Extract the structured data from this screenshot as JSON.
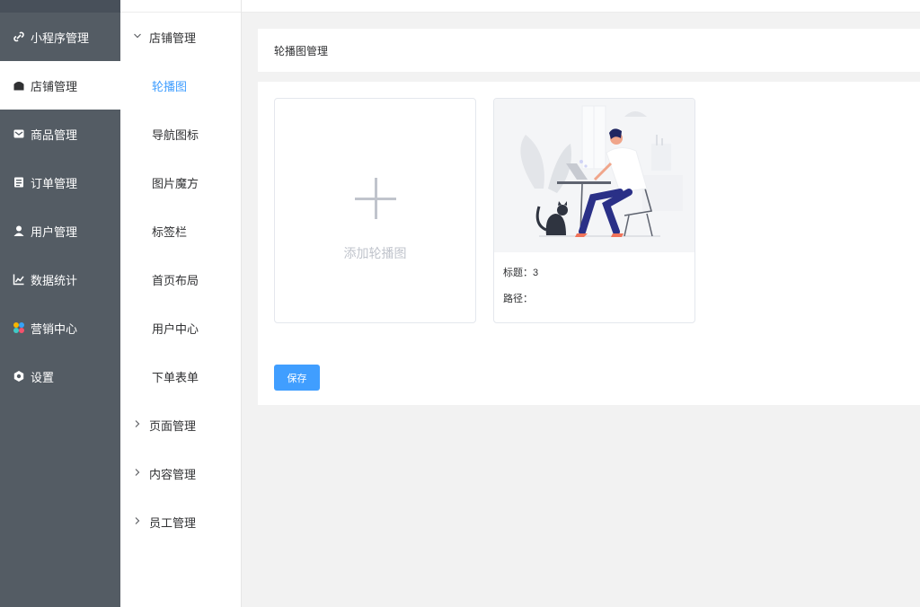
{
  "sidebar": {
    "items": [
      {
        "label": "小程序管理",
        "icon": "link-icon"
      },
      {
        "label": "店铺管理",
        "icon": "shop-icon",
        "active": true
      },
      {
        "label": "商品管理",
        "icon": "envelope-icon"
      },
      {
        "label": "订单管理",
        "icon": "clipboard-icon"
      },
      {
        "label": "用户管理",
        "icon": "user-icon"
      },
      {
        "label": "数据统计",
        "icon": "chart-icon"
      },
      {
        "label": "营销中心",
        "icon": "colorful-circles-icon"
      },
      {
        "label": "设置",
        "icon": "gear-icon"
      }
    ]
  },
  "submenu": {
    "group_open": "店铺管理",
    "items": [
      "轮播图",
      "导航图标",
      "图片魔方",
      "标签栏",
      "首页布局",
      "用户中心",
      "下单表单"
    ],
    "groups_closed": [
      "页面管理",
      "内容管理",
      "员工管理"
    ]
  },
  "header": {
    "title": "轮播图管理"
  },
  "carousel": {
    "add_label": "添加轮播图",
    "card": {
      "title_line": "标题：3",
      "path_line": "路径："
    }
  },
  "actions": {
    "save_label": "保存"
  },
  "colors": {
    "sidebar_bg": "#545c64",
    "accent": "#409eff"
  }
}
